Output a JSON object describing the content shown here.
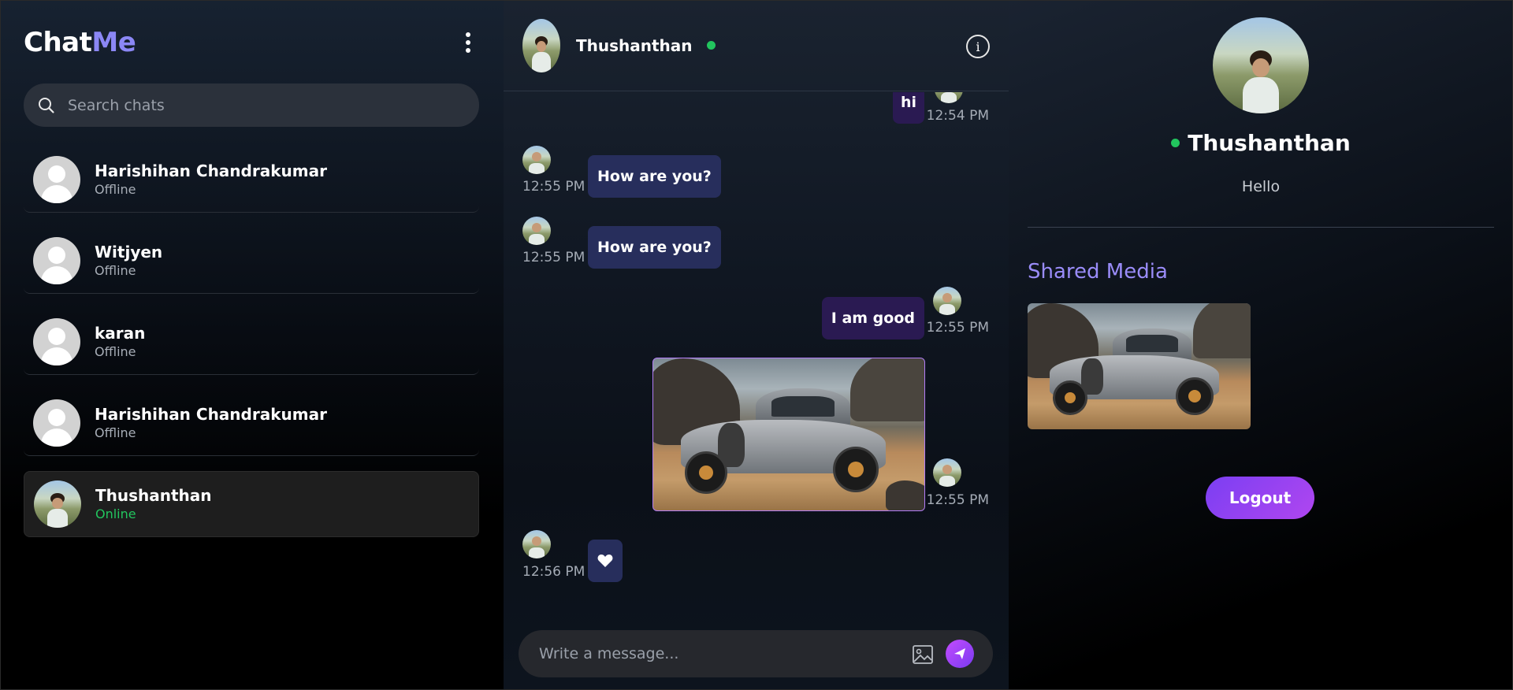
{
  "app": {
    "logo_main": "Chat",
    "logo_accent": "Me",
    "menu_icon": "kebab-menu-icon"
  },
  "search": {
    "placeholder": "Search chats",
    "icon": "search-icon"
  },
  "chat_list": [
    {
      "name": "Harishihan Chandrakumar",
      "status": "Offline",
      "avatar": "default-avatar"
    },
    {
      "name": "Witjyen",
      "status": "Offline",
      "avatar": "default-avatar"
    },
    {
      "name": "karan",
      "status": "Offline",
      "avatar": "default-avatar"
    },
    {
      "name": "Harishihan Chandrakumar",
      "status": "Offline",
      "avatar": "default-avatar"
    },
    {
      "name": "Thushanthan",
      "status": "Online",
      "avatar": "photo-avatar",
      "active": true
    }
  ],
  "chat_header": {
    "name": "Thushanthan",
    "online": true,
    "info_icon": "info-icon"
  },
  "messages": [
    {
      "side": "out",
      "text": "hi",
      "time": "12:54 PM"
    },
    {
      "side": "in",
      "text": "How are you?",
      "time": "12:55 PM"
    },
    {
      "side": "in",
      "text": "How are you?",
      "time": "12:55 PM"
    },
    {
      "side": "out",
      "text": "I am good",
      "time": "12:55 PM"
    },
    {
      "side": "out",
      "type": "image",
      "image": "vintage-car-image",
      "time": "12:55 PM"
    },
    {
      "side": "in",
      "type": "reaction",
      "icon": "heart-icon",
      "time": "12:56 PM"
    }
  ],
  "composer": {
    "placeholder": "Write a message...",
    "image_icon": "image-upload-icon",
    "send_icon": "send-icon"
  },
  "profile": {
    "name": "Thushanthan",
    "bio": "Hello",
    "shared_media_title": "Shared Media",
    "shared_media": [
      "vintage-car-image"
    ],
    "logout_label": "Logout"
  },
  "colors": {
    "accent_purple": "#8b87f5",
    "online_green": "#22c55e",
    "incoming_bubble": "#272e5c",
    "outgoing_bubble": "#2a1a52",
    "logout_gradient_start": "#7b3ff2",
    "logout_gradient_end": "#b046f0"
  }
}
